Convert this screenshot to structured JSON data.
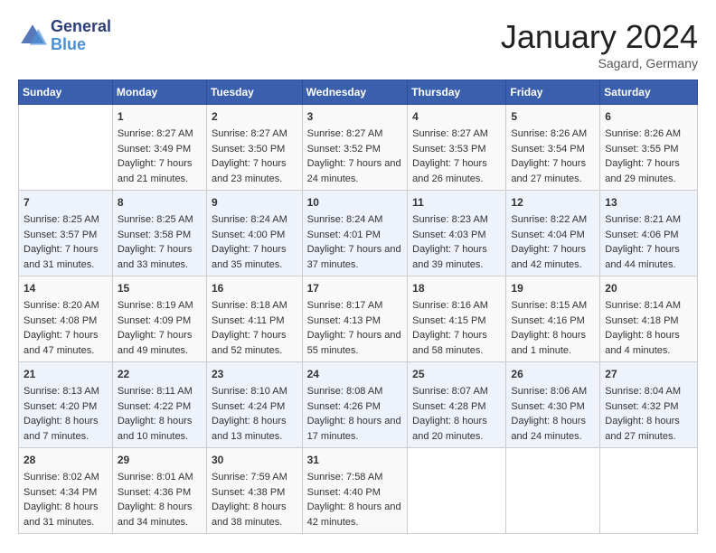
{
  "logo": {
    "line1": "General",
    "line2": "Blue"
  },
  "title": "January 2024",
  "location": "Sagard, Germany",
  "days_header": [
    "Sunday",
    "Monday",
    "Tuesday",
    "Wednesday",
    "Thursday",
    "Friday",
    "Saturday"
  ],
  "weeks": [
    [
      {
        "day": "",
        "sunrise": "",
        "sunset": "",
        "daylight": ""
      },
      {
        "day": "1",
        "sunrise": "Sunrise: 8:27 AM",
        "sunset": "Sunset: 3:49 PM",
        "daylight": "Daylight: 7 hours and 21 minutes."
      },
      {
        "day": "2",
        "sunrise": "Sunrise: 8:27 AM",
        "sunset": "Sunset: 3:50 PM",
        "daylight": "Daylight: 7 hours and 23 minutes."
      },
      {
        "day": "3",
        "sunrise": "Sunrise: 8:27 AM",
        "sunset": "Sunset: 3:52 PM",
        "daylight": "Daylight: 7 hours and 24 minutes."
      },
      {
        "day": "4",
        "sunrise": "Sunrise: 8:27 AM",
        "sunset": "Sunset: 3:53 PM",
        "daylight": "Daylight: 7 hours and 26 minutes."
      },
      {
        "day": "5",
        "sunrise": "Sunrise: 8:26 AM",
        "sunset": "Sunset: 3:54 PM",
        "daylight": "Daylight: 7 hours and 27 minutes."
      },
      {
        "day": "6",
        "sunrise": "Sunrise: 8:26 AM",
        "sunset": "Sunset: 3:55 PM",
        "daylight": "Daylight: 7 hours and 29 minutes."
      }
    ],
    [
      {
        "day": "7",
        "sunrise": "Sunrise: 8:25 AM",
        "sunset": "Sunset: 3:57 PM",
        "daylight": "Daylight: 7 hours and 31 minutes."
      },
      {
        "day": "8",
        "sunrise": "Sunrise: 8:25 AM",
        "sunset": "Sunset: 3:58 PM",
        "daylight": "Daylight: 7 hours and 33 minutes."
      },
      {
        "day": "9",
        "sunrise": "Sunrise: 8:24 AM",
        "sunset": "Sunset: 4:00 PM",
        "daylight": "Daylight: 7 hours and 35 minutes."
      },
      {
        "day": "10",
        "sunrise": "Sunrise: 8:24 AM",
        "sunset": "Sunset: 4:01 PM",
        "daylight": "Daylight: 7 hours and 37 minutes."
      },
      {
        "day": "11",
        "sunrise": "Sunrise: 8:23 AM",
        "sunset": "Sunset: 4:03 PM",
        "daylight": "Daylight: 7 hours and 39 minutes."
      },
      {
        "day": "12",
        "sunrise": "Sunrise: 8:22 AM",
        "sunset": "Sunset: 4:04 PM",
        "daylight": "Daylight: 7 hours and 42 minutes."
      },
      {
        "day": "13",
        "sunrise": "Sunrise: 8:21 AM",
        "sunset": "Sunset: 4:06 PM",
        "daylight": "Daylight: 7 hours and 44 minutes."
      }
    ],
    [
      {
        "day": "14",
        "sunrise": "Sunrise: 8:20 AM",
        "sunset": "Sunset: 4:08 PM",
        "daylight": "Daylight: 7 hours and 47 minutes."
      },
      {
        "day": "15",
        "sunrise": "Sunrise: 8:19 AM",
        "sunset": "Sunset: 4:09 PM",
        "daylight": "Daylight: 7 hours and 49 minutes."
      },
      {
        "day": "16",
        "sunrise": "Sunrise: 8:18 AM",
        "sunset": "Sunset: 4:11 PM",
        "daylight": "Daylight: 7 hours and 52 minutes."
      },
      {
        "day": "17",
        "sunrise": "Sunrise: 8:17 AM",
        "sunset": "Sunset: 4:13 PM",
        "daylight": "Daylight: 7 hours and 55 minutes."
      },
      {
        "day": "18",
        "sunrise": "Sunrise: 8:16 AM",
        "sunset": "Sunset: 4:15 PM",
        "daylight": "Daylight: 7 hours and 58 minutes."
      },
      {
        "day": "19",
        "sunrise": "Sunrise: 8:15 AM",
        "sunset": "Sunset: 4:16 PM",
        "daylight": "Daylight: 8 hours and 1 minute."
      },
      {
        "day": "20",
        "sunrise": "Sunrise: 8:14 AM",
        "sunset": "Sunset: 4:18 PM",
        "daylight": "Daylight: 8 hours and 4 minutes."
      }
    ],
    [
      {
        "day": "21",
        "sunrise": "Sunrise: 8:13 AM",
        "sunset": "Sunset: 4:20 PM",
        "daylight": "Daylight: 8 hours and 7 minutes."
      },
      {
        "day": "22",
        "sunrise": "Sunrise: 8:11 AM",
        "sunset": "Sunset: 4:22 PM",
        "daylight": "Daylight: 8 hours and 10 minutes."
      },
      {
        "day": "23",
        "sunrise": "Sunrise: 8:10 AM",
        "sunset": "Sunset: 4:24 PM",
        "daylight": "Daylight: 8 hours and 13 minutes."
      },
      {
        "day": "24",
        "sunrise": "Sunrise: 8:08 AM",
        "sunset": "Sunset: 4:26 PM",
        "daylight": "Daylight: 8 hours and 17 minutes."
      },
      {
        "day": "25",
        "sunrise": "Sunrise: 8:07 AM",
        "sunset": "Sunset: 4:28 PM",
        "daylight": "Daylight: 8 hours and 20 minutes."
      },
      {
        "day": "26",
        "sunrise": "Sunrise: 8:06 AM",
        "sunset": "Sunset: 4:30 PM",
        "daylight": "Daylight: 8 hours and 24 minutes."
      },
      {
        "day": "27",
        "sunrise": "Sunrise: 8:04 AM",
        "sunset": "Sunset: 4:32 PM",
        "daylight": "Daylight: 8 hours and 27 minutes."
      }
    ],
    [
      {
        "day": "28",
        "sunrise": "Sunrise: 8:02 AM",
        "sunset": "Sunset: 4:34 PM",
        "daylight": "Daylight: 8 hours and 31 minutes."
      },
      {
        "day": "29",
        "sunrise": "Sunrise: 8:01 AM",
        "sunset": "Sunset: 4:36 PM",
        "daylight": "Daylight: 8 hours and 34 minutes."
      },
      {
        "day": "30",
        "sunrise": "Sunrise: 7:59 AM",
        "sunset": "Sunset: 4:38 PM",
        "daylight": "Daylight: 8 hours and 38 minutes."
      },
      {
        "day": "31",
        "sunrise": "Sunrise: 7:58 AM",
        "sunset": "Sunset: 4:40 PM",
        "daylight": "Daylight: 8 hours and 42 minutes."
      },
      {
        "day": "",
        "sunrise": "",
        "sunset": "",
        "daylight": ""
      },
      {
        "day": "",
        "sunrise": "",
        "sunset": "",
        "daylight": ""
      },
      {
        "day": "",
        "sunrise": "",
        "sunset": "",
        "daylight": ""
      }
    ]
  ]
}
